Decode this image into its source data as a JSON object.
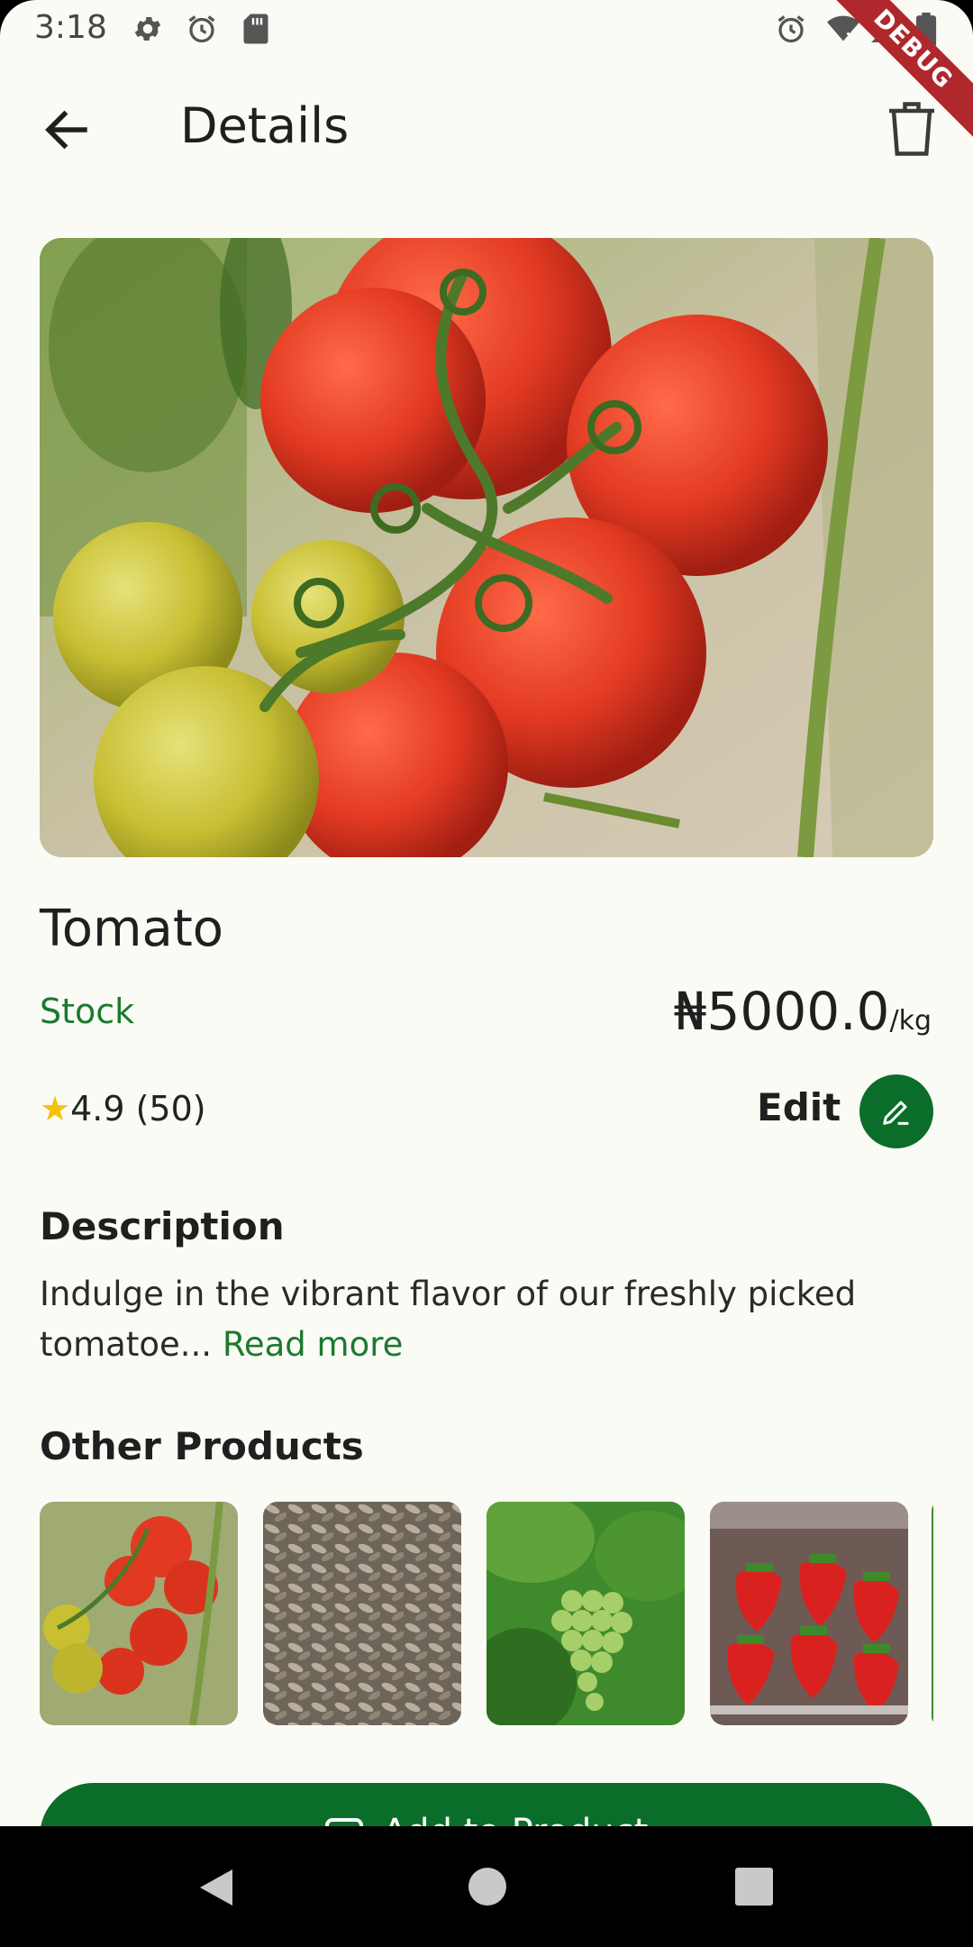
{
  "status_bar": {
    "time": "3:18",
    "debug_label": "DEBUG",
    "left_icons": [
      "gear-icon",
      "alarm-icon",
      "sd-card-icon"
    ],
    "right_icons": [
      "alarm-icon",
      "wifi-off-icon",
      "signal-icon",
      "battery-icon"
    ]
  },
  "app_bar": {
    "title": "Details",
    "back_icon": "arrow-left-icon",
    "delete_icon": "trash-icon"
  },
  "product": {
    "name": "Tomato",
    "stock_label": "Stock",
    "price": "₦5000.0",
    "price_unit": "/kg",
    "rating": "4.9 (50)",
    "edit_label": "Edit"
  },
  "description": {
    "heading": "Description",
    "text": "Indulge in the vibrant flavor of our freshly picked tomatoe...",
    "read_more": "Read more"
  },
  "other_products": {
    "heading": "Other Products",
    "items": [
      "tomato",
      "sunflower seeds",
      "grapes",
      "strawberries"
    ]
  },
  "primary_button": {
    "label": "Add to Product"
  },
  "colors": {
    "accent": "#0a6e2a",
    "background": "#fbfbf6",
    "star": "#f4c20d"
  }
}
